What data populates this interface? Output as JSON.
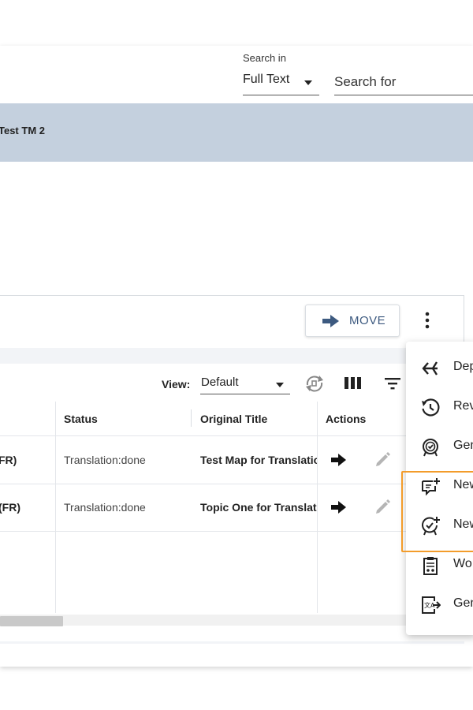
{
  "header": {
    "search_in_label": "Search in",
    "search_in_value": "Full Text",
    "search_placeholder": "Search for"
  },
  "banner": {
    "text": "Test TM 2"
  },
  "toolbar": {
    "move_label": "MOVE"
  },
  "grid": {
    "view_label": "View:",
    "view_value": "Default",
    "columns": [
      "Status",
      "Original Title",
      "Actions"
    ],
    "rows": [
      {
        "id": "FR)",
        "status": "Translation:done",
        "title": "Test Map for Translation"
      },
      {
        "id": "(FR)",
        "status": "Translation:done",
        "title": "Topic One for Translation"
      }
    ]
  },
  "menu": {
    "items": [
      {
        "label": "Dep",
        "icon": "branch-arrows-icon"
      },
      {
        "label": "Rev",
        "icon": "history-clock-icon"
      },
      {
        "label": "Gen",
        "icon": "generate-badge-icon"
      },
      {
        "label": "New",
        "icon": "new-review-comment-icon"
      },
      {
        "label": "New",
        "icon": "new-approval-badge-icon"
      },
      {
        "label": "Wo",
        "icon": "workflow-clipboard-icon"
      },
      {
        "label": "Gen",
        "icon": "translate-export-icon"
      }
    ]
  },
  "colors": {
    "banner": "#c4d0de",
    "accent_blue": "#3d5a80",
    "highlight_orange": "#f39c2b"
  }
}
